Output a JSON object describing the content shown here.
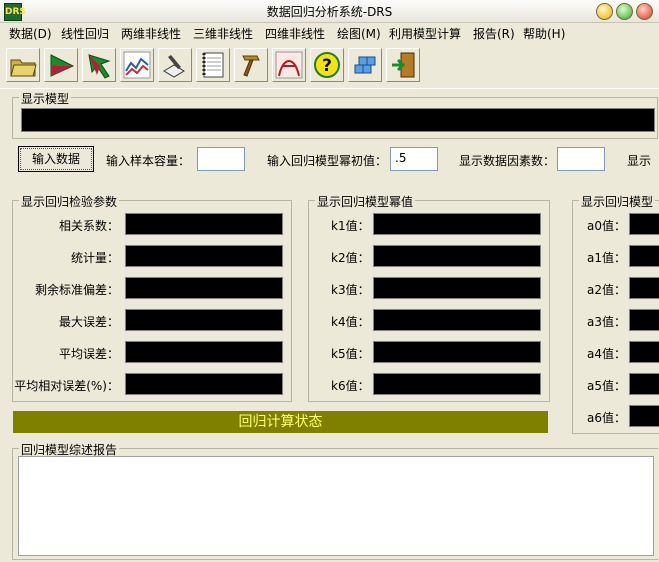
{
  "window": {
    "title": "数据回归分析系统-DRS",
    "icon_text": "DRS"
  },
  "menu": [
    {
      "label": "数据(D)"
    },
    {
      "label": "线性回归"
    },
    {
      "label": "两维非线性"
    },
    {
      "label": "三维非线性"
    },
    {
      "label": "四维非线性"
    },
    {
      "label": "绘图(M)"
    },
    {
      "label": "利用模型计算"
    },
    {
      "label": "报告(R)"
    },
    {
      "label": "帮助(H)"
    }
  ],
  "toolbar": [
    "open-folder-icon",
    "arrow-right-icon",
    "arrow-up-icon",
    "line-chart-icon",
    "draw-pen-icon",
    "notebook-icon",
    "hammer-icon",
    "curve-a-icon",
    "help-icon",
    "cubes-icon",
    "exit-door-icon"
  ],
  "model_display": {
    "label": "显示模型",
    "value": ""
  },
  "input": {
    "button": "输入数据",
    "sample_size_label": "输入样本容量：",
    "sample_size_value": "",
    "power_label": "输入回归模型幂初值：",
    "power_value": ".5",
    "factor_label": "显示数据因素数：",
    "factor_value": "",
    "extra_label": "显示"
  },
  "stats": {
    "title": "显示回归检验参数",
    "rows": [
      {
        "label": "相关系数："
      },
      {
        "label": "统计量："
      },
      {
        "label": "剩余标准偏差："
      },
      {
        "label": "最大误差："
      },
      {
        "label": "平均误差："
      },
      {
        "label": "平均相对误差(%)："
      }
    ]
  },
  "powers": {
    "title": "显示回归模型幂值",
    "rows": [
      {
        "label": "k1值："
      },
      {
        "label": "k2值："
      },
      {
        "label": "k3值："
      },
      {
        "label": "k4值："
      },
      {
        "label": "k5值："
      },
      {
        "label": "k6值："
      }
    ]
  },
  "coeffs": {
    "title": "显示回归模型",
    "rows": [
      {
        "label": "a0值："
      },
      {
        "label": "a1值："
      },
      {
        "label": "a2值："
      },
      {
        "label": "a3值："
      },
      {
        "label": "a4值："
      },
      {
        "label": "a5值："
      },
      {
        "label": "a6值："
      }
    ]
  },
  "status": "回归计算状态",
  "report": {
    "title": "回归模型综述报告",
    "text": ""
  },
  "colors": {
    "status_bg": "#808000",
    "status_text": "#ffff66",
    "field_bg": "#000000"
  }
}
